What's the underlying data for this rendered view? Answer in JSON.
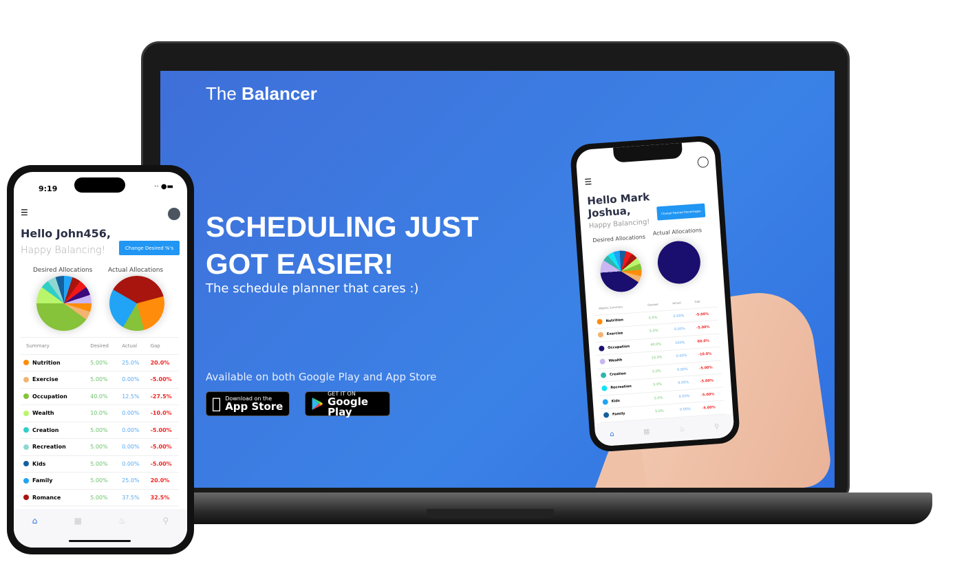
{
  "brand": {
    "light": "The",
    "bold": "Balancer"
  },
  "hero": {
    "headline": "SCHEDULING JUST GOT EASIER!",
    "tagline": "The schedule planner that cares :)",
    "availability": "Available on both Google Play and App Store"
  },
  "stores": [
    {
      "small": "Download on the",
      "big": "App Store",
      "icon": "apple-icon"
    },
    {
      "small": "GET IT ON",
      "big": "Google Play",
      "icon": "google-play-icon"
    }
  ],
  "phone_left": {
    "time": "9:19",
    "greeting": "Hello John456,",
    "subgreeting": "Happy Balancing!",
    "button": "Change Desired %'s",
    "desired_title": "Desired Allocations",
    "actual_title": "Actual Allocations",
    "headers": [
      "Summary",
      "Desired",
      "Actual",
      "Gap"
    ],
    "rows": [
      {
        "name": "Nutrition",
        "color": "#ff8c0a",
        "desired": "5.00%",
        "actual": "25.0%",
        "gap": "20.0%"
      },
      {
        "name": "Exercise",
        "color": "#f2b46e",
        "desired": "5.00%",
        "actual": "0.00%",
        "gap": "-5.00%"
      },
      {
        "name": "Occupation",
        "color": "#86c23a",
        "desired": "40.0%",
        "actual": "12.5%",
        "gap": "-27.5%"
      },
      {
        "name": "Wealth",
        "color": "#b9f56a",
        "desired": "10.0%",
        "actual": "0.00%",
        "gap": "-10.0%"
      },
      {
        "name": "Creation",
        "color": "#2fcfc7",
        "desired": "5.00%",
        "actual": "0.00%",
        "gap": "-5.00%"
      },
      {
        "name": "Recreation",
        "color": "#8fd8d2",
        "desired": "5.00%",
        "actual": "0.00%",
        "gap": "-5.00%"
      },
      {
        "name": "Kids",
        "color": "#15609e",
        "desired": "5.00%",
        "actual": "0.00%",
        "gap": "-5.00%"
      },
      {
        "name": "Family",
        "color": "#21a4f5",
        "desired": "5.00%",
        "actual": "25.0%",
        "gap": "20.0%"
      },
      {
        "name": "Romance",
        "color": "#a8150f",
        "desired": "5.00%",
        "actual": "37.5%",
        "gap": "32.5%"
      }
    ],
    "desired_pie": [
      [
        5,
        "#21a4f5"
      ],
      [
        5,
        "#a8150f"
      ],
      [
        5,
        "#f01818"
      ],
      [
        5,
        "#3c0a7a"
      ],
      [
        5,
        "#c9b6f2"
      ],
      [
        5,
        "#ff8c0a"
      ],
      [
        5,
        "#f2b46e"
      ],
      [
        40,
        "#86c23a"
      ],
      [
        10,
        "#b9f56a"
      ],
      [
        5,
        "#2fcfc7"
      ],
      [
        5,
        "#8fd8d2"
      ],
      [
        5,
        "#15609e"
      ]
    ],
    "actual_pie": [
      [
        37.5,
        "#a8150f"
      ],
      [
        25,
        "#ff8c0a"
      ],
      [
        12.5,
        "#86c23a"
      ],
      [
        25,
        "#21a4f5"
      ]
    ]
  },
  "phone_right": {
    "greeting": "Hello Mark Joshua,",
    "subgreeting": "Happy Balancing!",
    "button": "Change Desired Percentages",
    "desired_title": "Desired Allocations",
    "actual_title": "Actual Allocations",
    "headers": [
      "Weekly Summary",
      "Desired",
      "Actual",
      "Gap"
    ],
    "rows": [
      {
        "name": "Nutrition",
        "color": "#ff8c0a",
        "desired": "5.0%",
        "actual": "0.00%",
        "gap": "-5.00%"
      },
      {
        "name": "Exercise",
        "color": "#f2b46e",
        "desired": "5.0%",
        "actual": "0.00%",
        "gap": "-5.00%"
      },
      {
        "name": "Occupation",
        "color": "#1a0f6e",
        "desired": "40.0%",
        "actual": "100%",
        "gap": "60.0%"
      },
      {
        "name": "Wealth",
        "color": "#c9b6f2",
        "desired": "10.0%",
        "actual": "0.00%",
        "gap": "-10.0%"
      },
      {
        "name": "Creation",
        "color": "#2fb5ad",
        "desired": "5.0%",
        "actual": "0.00%",
        "gap": "-5.00%"
      },
      {
        "name": "Recreation",
        "color": "#12e4f5",
        "desired": "5.0%",
        "actual": "0.00%",
        "gap": "-5.00%"
      },
      {
        "name": "Kids",
        "color": "#21a4f5",
        "desired": "5.0%",
        "actual": "0.00%",
        "gap": "-5.00%"
      },
      {
        "name": "Family",
        "color": "#15609e",
        "desired": "5.0%",
        "actual": "0.00%",
        "gap": "-5.00%"
      }
    ],
    "desired_pie": [
      [
        5,
        "#15609e"
      ],
      [
        5,
        "#f01818"
      ],
      [
        5,
        "#a8150f"
      ],
      [
        5,
        "#b9f56a"
      ],
      [
        5,
        "#86c23a"
      ],
      [
        5,
        "#ff8c0a"
      ],
      [
        5,
        "#f2b46e"
      ],
      [
        40,
        "#1a0f6e"
      ],
      [
        10,
        "#c9b6f2"
      ],
      [
        5,
        "#2fb5ad"
      ],
      [
        5,
        "#12e4f5"
      ],
      [
        5,
        "#21a4f5"
      ]
    ],
    "actual_pie": [
      [
        100,
        "#1a0f6e"
      ]
    ]
  },
  "colors": {
    "accent": "#2196f3",
    "desired": "#6cc36c",
    "actual": "#5aa9f0",
    "gap": "#f02525",
    "navy": "#2a2f45"
  }
}
